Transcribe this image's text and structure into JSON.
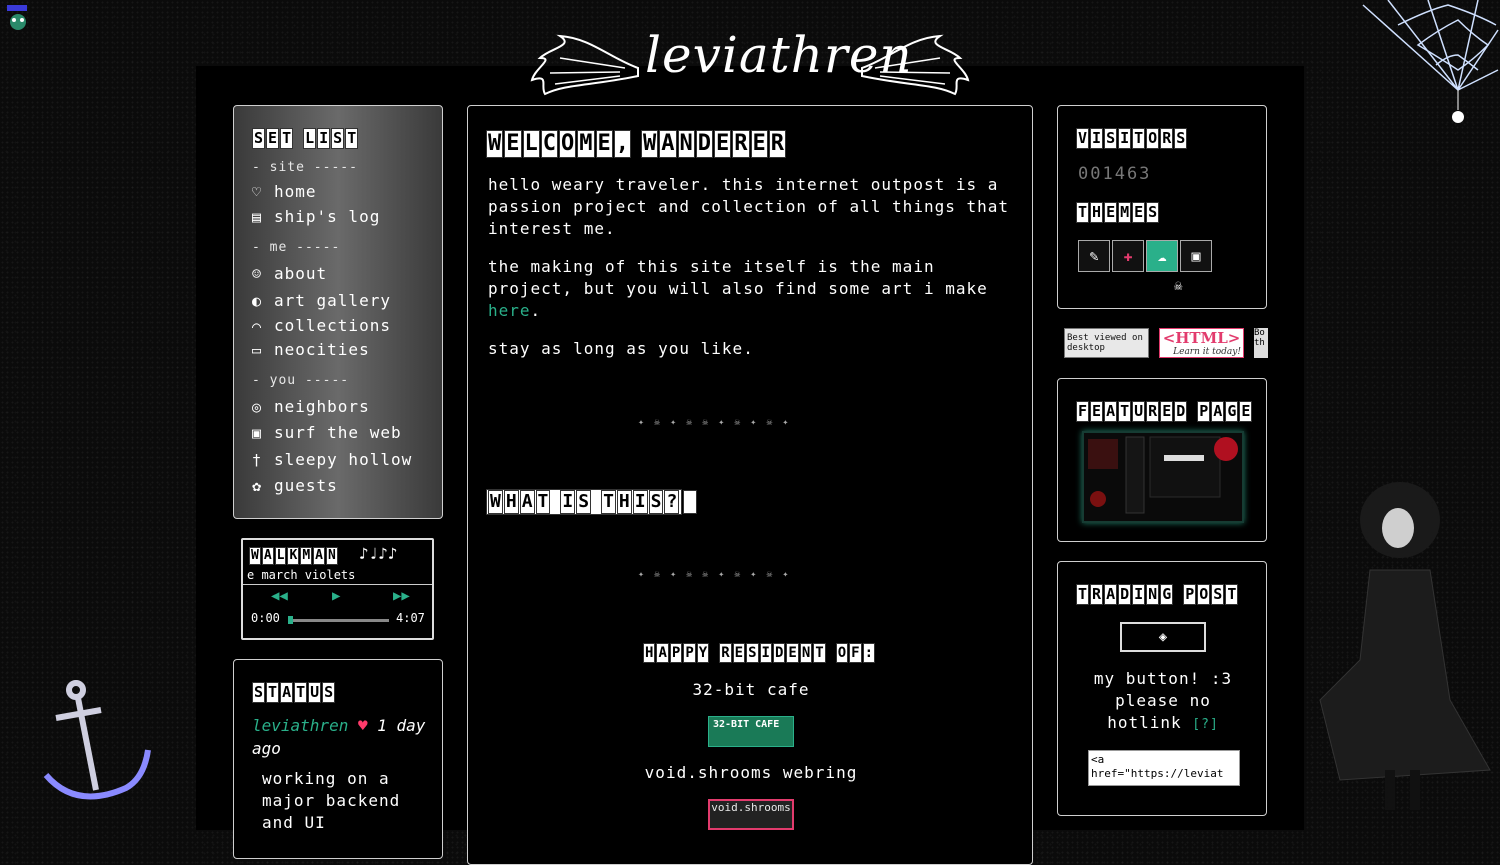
{
  "site": {
    "logo_text": "leviathren"
  },
  "nav": {
    "title": "SET LIST",
    "sections": [
      {
        "label": "- site -----",
        "items": [
          {
            "icon": "♡",
            "label": "home"
          },
          {
            "icon": "▤",
            "label": "ship's log"
          }
        ]
      },
      {
        "label": "- me -----",
        "items": [
          {
            "icon": "☺",
            "label": "about"
          },
          {
            "icon": "◐",
            "label": "art gallery"
          },
          {
            "icon": "⌒",
            "label": "collections"
          },
          {
            "icon": "▭",
            "label": "neocities"
          }
        ]
      },
      {
        "label": "- you -----",
        "items": [
          {
            "icon": "◎",
            "label": "neighbors"
          },
          {
            "icon": "▣",
            "label": "surf the web"
          },
          {
            "icon": "†",
            "label": "sleepy hollow"
          },
          {
            "icon": "✿",
            "label": "guests"
          }
        ]
      }
    ]
  },
  "walkman": {
    "title": "WALKMAN",
    "notes": "♪♩♪♪",
    "track": "e march violets",
    "rewind_icon": "◀◀",
    "play_icon": "▶",
    "forward_icon": "▶▶",
    "time_current": "0:00",
    "time_total": "4:07",
    "progress": 0.0
  },
  "status": {
    "title": "STATUS",
    "user": "leviathren",
    "heart": "♥",
    "time_ago": "1 day ago",
    "message": "working on a major backend and UI"
  },
  "main": {
    "title": "WELCOME, WANDERER",
    "para1": "hello weary traveler. this internet outpost is a passion project and collection of all things that interest me.",
    "para2_before": "the making of this site itself is the main project, but you will also find some art i make ",
    "para2_link": "here",
    "para2_after": ".",
    "para3": "stay as long as you like.",
    "divider": "✦ ☠ ✦ ☠ ☠ ✦ ☠ ✦ ☠ ✦",
    "what_title": "WHAT IS THIS?",
    "what_arrow": "➡",
    "resident_title": "HAPPY RESIDENT OF:",
    "cafe_label": "32-bit cafe",
    "cafe_badge": "32-BIT CAFE",
    "webring_label": "void.shrooms webring",
    "webring_badge": "void.shrooms"
  },
  "visitors": {
    "title": "VISITORS",
    "count": "001463",
    "themes_title": "THEMES",
    "themes": [
      "✎",
      "✚",
      "☁",
      "▣"
    ],
    "skull": "☠"
  },
  "buttons88": {
    "best_viewed": "Best viewed on desktop",
    "html_main": "<HTML>",
    "html_sub": "Learn it today!",
    "third": "Bo th"
  },
  "featured": {
    "title": "FEATURED PAGE"
  },
  "trading": {
    "title": "TRADING POST",
    "button_icon": "◈",
    "text1": "my button! :3",
    "text2": "please no",
    "text3": "hotlink",
    "help": "[?]",
    "code": "<a\nhref=\"https://leviat"
  },
  "colors": {
    "accent": "#2ab08a",
    "heart": "#ff3b6b",
    "webring": "#e23b6d"
  }
}
